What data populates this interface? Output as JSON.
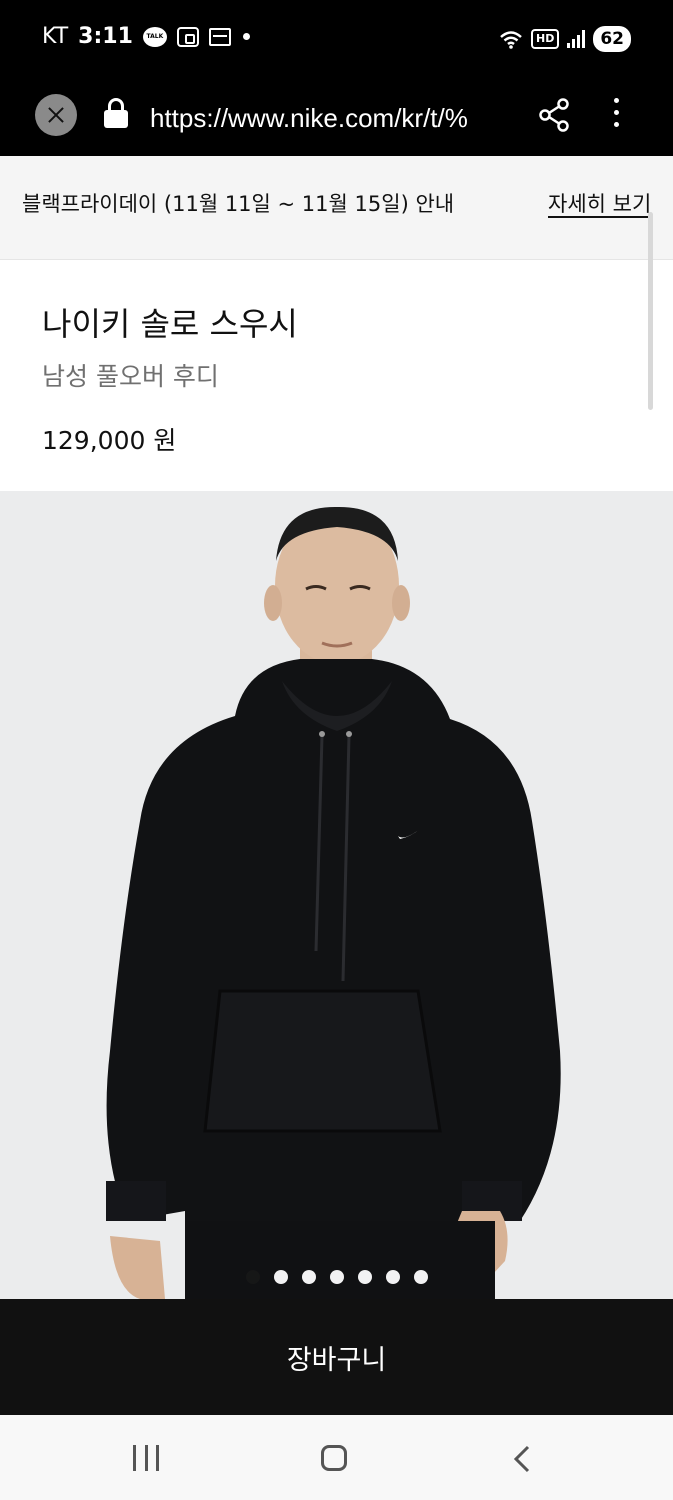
{
  "status_bar": {
    "carrier": "KT",
    "time": "3:11",
    "talk_label": "TALK",
    "hd_label": "HD",
    "battery": "62"
  },
  "browser": {
    "url": "https://www.nike.com/kr/t/%"
  },
  "promo": {
    "text": "블랙프라이데이 (11월 11일 ~ 11월 15일) 안내",
    "link": "자세히 보기"
  },
  "product": {
    "title": "나이키 솔로 스우시",
    "subtitle": "남성 풀오버 후디",
    "price": "129,000 원"
  },
  "gallery": {
    "image_count": 7,
    "active_index": 0
  },
  "cart": {
    "label": "장바구니"
  },
  "colors": {
    "background": "#ffffff",
    "bar": "#000000",
    "cart_button": "#111111",
    "promo_bg": "#f5f5f5",
    "subtitle": "#707070"
  }
}
